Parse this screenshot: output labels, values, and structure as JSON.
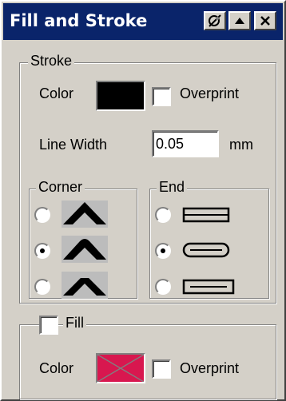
{
  "window": {
    "title": "Fill and Stroke",
    "buttons": [
      "pin-icon",
      "minimize-icon",
      "close-icon"
    ]
  },
  "stroke": {
    "legend": "Stroke",
    "color_label": "Color",
    "color_value": "#000000",
    "overprint_label": "Overprint",
    "overprint_checked": false,
    "line_width_label": "Line Width",
    "line_width_value": "0.05",
    "line_width_unit": "mm",
    "corner": {
      "legend": "Corner",
      "options": [
        {
          "icon": "miter-corner-icon",
          "selected": false
        },
        {
          "icon": "round-corner-icon",
          "selected": true
        },
        {
          "icon": "bevel-corner-icon",
          "selected": false
        }
      ]
    },
    "end": {
      "legend": "End",
      "options": [
        {
          "icon": "butt-cap-icon",
          "selected": false
        },
        {
          "icon": "round-cap-icon",
          "selected": true
        },
        {
          "icon": "square-cap-icon",
          "selected": false
        }
      ]
    }
  },
  "fill": {
    "label": "Fill",
    "checked": false,
    "color_label": "Color",
    "color_value": "#d8174f",
    "overprint_label": "Overprint",
    "overprint_checked": false
  }
}
